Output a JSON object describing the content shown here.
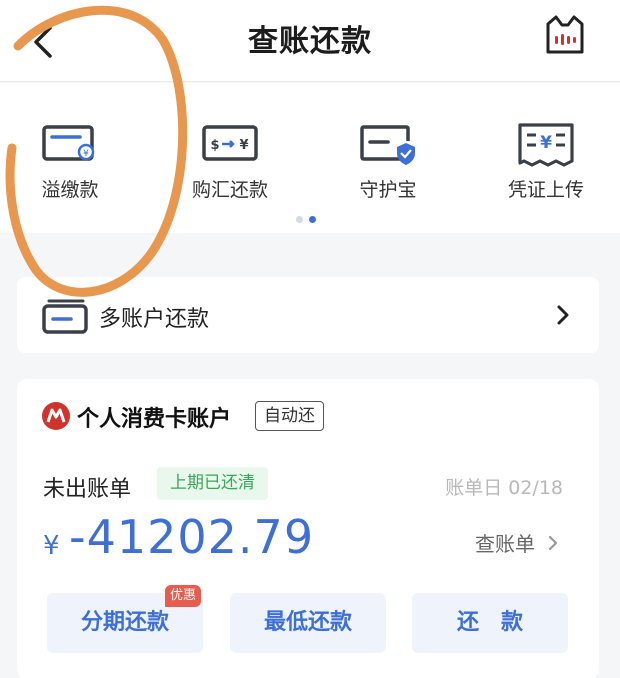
{
  "header": {
    "title": "查账还款",
    "back_icon": "back-icon",
    "mascot_icon": "cat-mascot-icon"
  },
  "quick_actions": {
    "items": [
      {
        "label": "溢缴款",
        "icon": "card-coin-icon"
      },
      {
        "label": "购汇还款",
        "icon": "currency-exchange-icon"
      },
      {
        "label": "守护宝",
        "icon": "card-shield-icon"
      },
      {
        "label": "凭证上传",
        "icon": "receipt-icon"
      }
    ],
    "page_count": 2,
    "active_page": 2
  },
  "multi_account": {
    "label": "多账户还款",
    "icon": "card-stack-icon"
  },
  "account": {
    "name": "个人消费卡账户",
    "auto_tag": "自动还",
    "bill_label": "未出账单",
    "status_tag": "上期已还清",
    "bill_date": "账单日 02/18",
    "currency": "¥",
    "amount": "-41202.79",
    "view_bill": "查账单",
    "buttons": {
      "installment": "分期还款",
      "installment_badge": "优惠",
      "minimum": "最低还款",
      "repay": "还款"
    }
  },
  "colors": {
    "accent": "#3d6fd6",
    "brand_red": "#d0322c",
    "success_green": "#38a857",
    "annotation_orange": "#e8974f"
  }
}
